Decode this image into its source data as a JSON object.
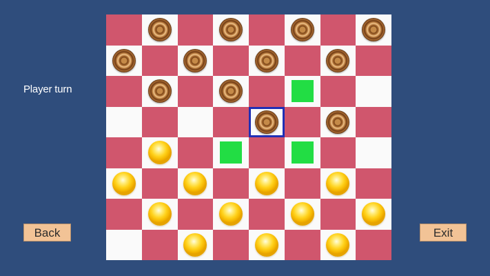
{
  "status_text": "Player turn",
  "buttons": {
    "back_label": "Back",
    "exit_label": "Exit"
  },
  "board": {
    "rows": 8,
    "cols": 8,
    "top_left_color": "dark",
    "colors": {
      "dark": "#d0566d",
      "light": "#fafafa",
      "move": "#22dd44",
      "selected": "#1f2fb5"
    },
    "pieces": [
      {
        "row": 0,
        "col": 1,
        "color": "brown"
      },
      {
        "row": 0,
        "col": 3,
        "color": "brown"
      },
      {
        "row": 0,
        "col": 5,
        "color": "brown"
      },
      {
        "row": 0,
        "col": 7,
        "color": "brown"
      },
      {
        "row": 1,
        "col": 0,
        "color": "brown"
      },
      {
        "row": 1,
        "col": 2,
        "color": "brown"
      },
      {
        "row": 1,
        "col": 4,
        "color": "brown"
      },
      {
        "row": 1,
        "col": 6,
        "color": "brown"
      },
      {
        "row": 2,
        "col": 1,
        "color": "brown"
      },
      {
        "row": 2,
        "col": 3,
        "color": "brown"
      },
      {
        "row": 3,
        "col": 4,
        "color": "brown",
        "selected": true
      },
      {
        "row": 3,
        "col": 6,
        "color": "brown"
      },
      {
        "row": 4,
        "col": 1,
        "color": "yellow"
      },
      {
        "row": 5,
        "col": 0,
        "color": "yellow"
      },
      {
        "row": 5,
        "col": 2,
        "color": "yellow"
      },
      {
        "row": 5,
        "col": 4,
        "color": "yellow"
      },
      {
        "row": 5,
        "col": 6,
        "color": "yellow"
      },
      {
        "row": 6,
        "col": 1,
        "color": "yellow"
      },
      {
        "row": 6,
        "col": 3,
        "color": "yellow"
      },
      {
        "row": 6,
        "col": 5,
        "color": "yellow"
      },
      {
        "row": 6,
        "col": 7,
        "color": "yellow"
      },
      {
        "row": 7,
        "col": 2,
        "color": "yellow"
      },
      {
        "row": 7,
        "col": 4,
        "color": "yellow"
      },
      {
        "row": 7,
        "col": 6,
        "color": "yellow"
      }
    ],
    "move_markers": [
      {
        "row": 2,
        "col": 5
      },
      {
        "row": 4,
        "col": 3
      },
      {
        "row": 4,
        "col": 5
      }
    ]
  }
}
